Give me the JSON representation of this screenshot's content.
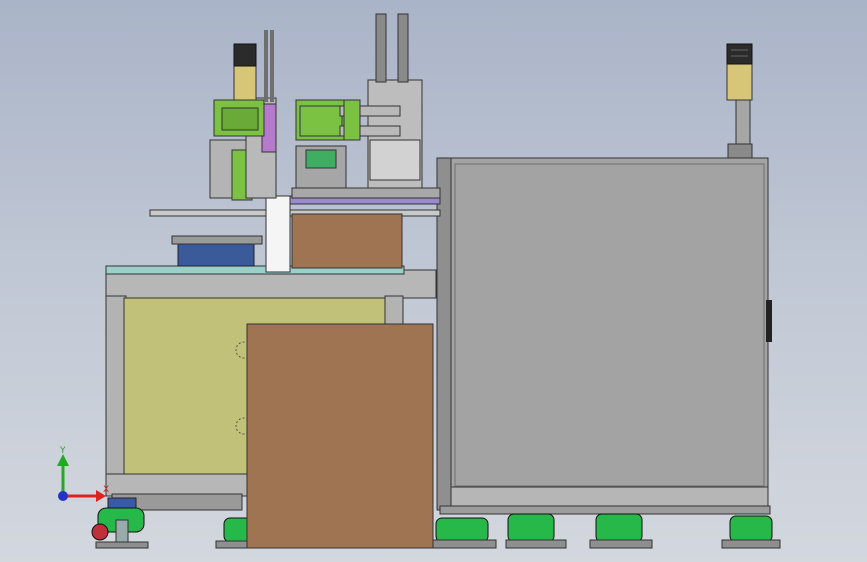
{
  "triad": {
    "y_label": "Y",
    "x_label": "X",
    "y_color": "#22aa22",
    "x_color": "#dd2222",
    "z_color": "#2233cc"
  },
  "colors": {
    "background_top": "#aab4c8",
    "background_bottom": "#d3d7de",
    "cabinet_gray": "#a3a3a3",
    "panel_olive": "#c2c17a",
    "cardboard_brown": "#9f7453",
    "foot_green": "#22c14a",
    "mechanism_green": "#7bc142",
    "motor_blue": "#3a5a9a"
  }
}
